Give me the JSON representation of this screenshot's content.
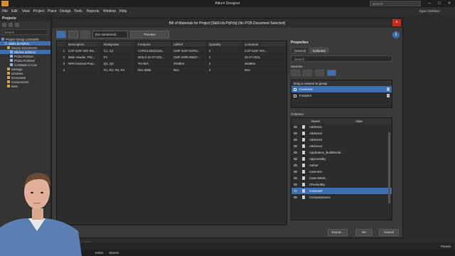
{
  "app": {
    "title": "Altium Designer",
    "search_placeholder": "Search",
    "user": "Egor Cherikov"
  },
  "menu": [
    "File",
    "Edit",
    "View",
    "Project",
    "Place",
    "Design",
    "Tools",
    "Reports",
    "Window",
    "Help"
  ],
  "projects": {
    "header": "Projects",
    "search_placeholder": "Search",
    "tree": [
      {
        "label": "Project Group 1.DsnWrk",
        "indent": 0,
        "selected": false
      },
      {
        "label": "Skill-Lib.PrjPcb",
        "indent": 1,
        "selected": true
      },
      {
        "label": "Source Documents",
        "indent": 2,
        "selected": false
      },
      {
        "label": "Sheet1.SchDoc",
        "indent": 3,
        "selected": true
      },
      {
        "label": "PCB1.PcbDoc",
        "indent": 3,
        "selected": false
      },
      {
        "label": "PCB1.PCBDwf",
        "indent": 3,
        "selected": false
      },
      {
        "label": "CAMtastic1.Cam",
        "indent": 3,
        "selected": false
      },
      {
        "label": "Settings",
        "indent": 2,
        "selected": false
      },
      {
        "label": "Libraries",
        "indent": 2,
        "selected": false
      },
      {
        "label": "Generated",
        "indent": 2,
        "selected": false
      },
      {
        "label": "Components",
        "indent": 2,
        "selected": false
      },
      {
        "label": "Nets",
        "indent": 2,
        "selected": false
      }
    ]
  },
  "dialog": {
    "title": "Bill of Materials for Project [Skill-Lib.PrjPcb] (No PCB Document Selected)",
    "close": "×",
    "variations": "[No Variations]",
    "preview": "Preview",
    "info": "i",
    "grid": {
      "headers": [
        "Description",
        "Designator",
        "Footprint",
        "LibRef",
        "Quantity",
        "Comment"
      ],
      "rows": [
        {
          "num": "1",
          "cells": [
            "CAP 22nF 50V 5%...",
            "C1, C2",
            "CAPC1206(3216)...",
            "CMP-1037-03764...",
            "2",
            "CAP 22nF 50V..."
          ]
        },
        {
          "num": "2",
          "cells": [
            "Male Header, Pitc...",
            "P1",
            "MOLX-22-27-202...",
            "CMP-2000-05537...",
            "1",
            "22-27-2021"
          ]
        },
        {
          "num": "3",
          "cells": [
            "NPN General Purp...",
            "Q1, Q2",
            "TO-92A",
            "2N3904",
            "2",
            "2N3904"
          ]
        },
        {
          "num": "4",
          "cells": [
            "",
            "R1, R2, R3, R4",
            "Res 0805",
            "Res",
            "4",
            "Res"
          ]
        }
      ],
      "footer": "4 lines, 4 rows visible"
    },
    "properties": {
      "title": "Properties",
      "tabs": [
        "General",
        "Columns"
      ],
      "search_placeholder": "Search",
      "sources_label": "Sources",
      "group_label": "Drag a column to group",
      "group_rows": [
        "Comment",
        "Footprint"
      ],
      "columns_label": "Columns",
      "columns_headers": [
        "Name",
        "Alias"
      ],
      "columns": [
        {
          "name": "Address1",
          "selected": false
        },
        {
          "name": "Address2",
          "selected": false
        },
        {
          "name": "Address3",
          "selected": false
        },
        {
          "name": "Address4",
          "selected": false
        },
        {
          "name": "Application_BuildNumb...",
          "selected": false
        },
        {
          "name": "ApprovedBy",
          "selected": false
        },
        {
          "name": "Author",
          "selected": false
        },
        {
          "name": "Case-EIA",
          "selected": false
        },
        {
          "name": "Case-Metric",
          "selected": false
        },
        {
          "name": "CheckedBy",
          "selected": false
        },
        {
          "name": "Comment",
          "selected": true
        },
        {
          "name": "CompanyName",
          "selected": false
        }
      ]
    },
    "buttons": {
      "export": "Export...",
      "ok": "OK",
      "cancel": "Cancel"
    }
  },
  "bottom": {
    "editor_tab": "Editor",
    "sheet_tab": "Sheet1",
    "panels": "Panels"
  }
}
